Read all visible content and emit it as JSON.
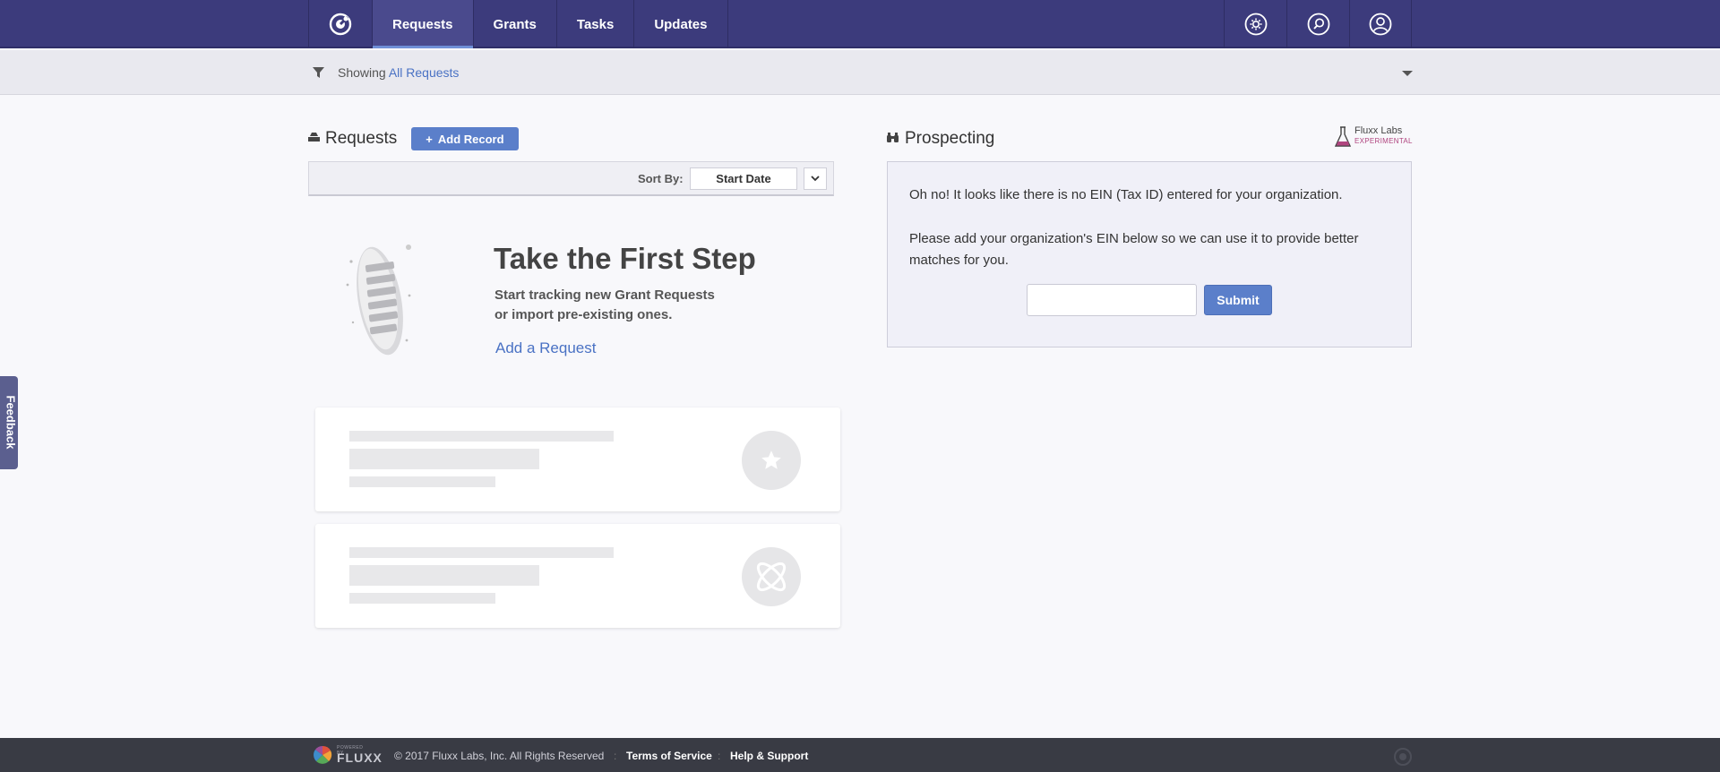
{
  "nav": {
    "logo_icon": "fluxx-logo-icon",
    "tabs": [
      {
        "label": "Requests",
        "active": true
      },
      {
        "label": "Grants",
        "active": false
      },
      {
        "label": "Tasks",
        "active": false
      },
      {
        "label": "Updates",
        "active": false
      }
    ],
    "right_icons": [
      "settings-icon",
      "search-icon",
      "user-icon"
    ]
  },
  "filter": {
    "prefix": "Showing",
    "value": "All Requests"
  },
  "requests": {
    "title": "Requests",
    "add_button": "Add Record",
    "add_button_prefix": "+",
    "sort_label": "Sort By:",
    "sort_value": "Start Date",
    "empty": {
      "title": "Take the First Step",
      "line1": "Start tracking new Grant Requests",
      "line2": "or import pre-existing ones.",
      "link": "Add a Request"
    },
    "placeholder_icons": [
      "star-icon",
      "atom-icon"
    ]
  },
  "prospecting": {
    "title": "Prospecting",
    "labs_name": "Fluxx Labs",
    "labs_tag": "EXPERIMENTAL",
    "message1": "Oh no! It looks like there is no EIN (Tax ID) entered for your organization.",
    "message2": "Please add your organization's EIN below so we can use it to provide better matches for you.",
    "ein_value": "",
    "submit_label": "Submit"
  },
  "feedback_label": "Feedback",
  "footer": {
    "powered_by": "POWERED BY",
    "brand": "FLUXX",
    "copyright": "© 2017 Fluxx Labs, Inc. All Rights Reserved",
    "separator": ":",
    "links": [
      "Terms of Service",
      "Help & Support"
    ]
  },
  "colors": {
    "nav_bg": "#3c3b7c",
    "accent": "#5b7fca",
    "link": "#4a72c4",
    "footer_bg": "#393b44"
  }
}
